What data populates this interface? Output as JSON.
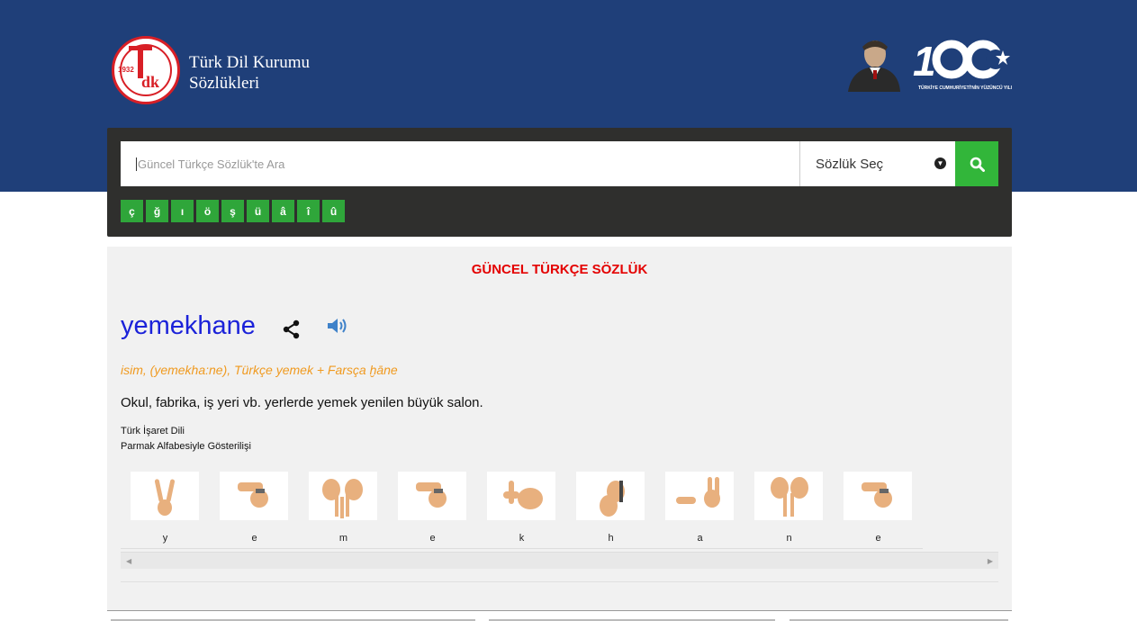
{
  "header": {
    "brand_line1": "Türk Dil Kurumu",
    "brand_line2": "Sözlükleri",
    "logo_year": "1932",
    "logo_letters": "dk",
    "anniversary_tagline": "TÜRKİYE CUMHURİYETİ'NİN YÜZÜNCÜ YILI",
    "anniversary_number": "100"
  },
  "search": {
    "placeholder": "Güncel Türkçe Sözlük'te Ara",
    "dictionary_select": "Sözlük Seç",
    "special_chars": [
      "ç",
      "ğ",
      "ı",
      "ö",
      "ş",
      "ü",
      "â",
      "î",
      "û"
    ]
  },
  "result": {
    "dictionary_title": "GÜNCEL TÜRKÇE SÖZLÜK",
    "word": "yemekhane",
    "meta": "isim, (yemekha:ne), Türkçe yemek + Farsça ḫāne",
    "definition": "Okul, fabrika, iş yeri vb. yerlerde yemek yenilen büyük salon.",
    "sign_language_label": "Türk İşaret Dili",
    "sign_language_sub": "Parmak Alfabesiyle Gösterilişi",
    "letters": [
      "y",
      "e",
      "m",
      "e",
      "k",
      "h",
      "a",
      "n",
      "e"
    ]
  },
  "colors": {
    "header_band": "#1f3f79",
    "search_panel": "#2f2f2d",
    "accent_green": "#32b63a",
    "dict_title": "#e40000",
    "word": "#1b22d9",
    "meta": "#f09a20",
    "skin": "#e8b07e"
  },
  "icons": {
    "search_button": "search-icon",
    "share": "share-icon",
    "audio": "speaker-icon",
    "dropdown": "chevron-down-icon"
  }
}
